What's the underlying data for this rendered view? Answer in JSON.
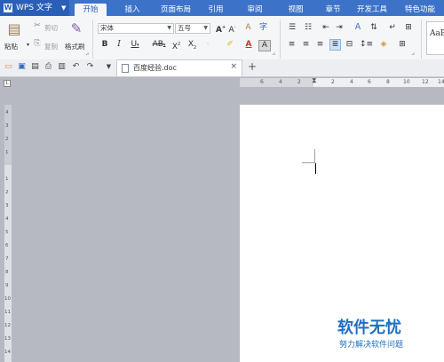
{
  "app": {
    "name": "WPS 文字",
    "logo_letter": "W"
  },
  "tabs": [
    "开始",
    "插入",
    "页面布局",
    "引用",
    "审阅",
    "视图",
    "章节",
    "开发工具",
    "特色功能"
  ],
  "clipboard": {
    "paste": "粘贴",
    "cut": "剪切",
    "copy": "复制",
    "format_painter": "格式刷"
  },
  "font": {
    "name": "宋体",
    "size": "五号"
  },
  "styles_preview": "AaB",
  "document": {
    "tab_title": "百度经验.doc"
  },
  "ruler": {
    "h_numbers": [
      "6",
      "4",
      "2",
      "2",
      "4",
      "6",
      "8",
      "10",
      "12",
      "14",
      "16",
      "18"
    ],
    "v_numbers": [
      "4",
      "3",
      "2",
      "1",
      "1",
      "2",
      "3",
      "4",
      "5",
      "6",
      "7",
      "8",
      "9",
      "10",
      "11",
      "12",
      "13",
      "14"
    ]
  },
  "watermark": {
    "title": "软件无忧",
    "subtitle": "努力解决软件问题"
  },
  "icons": [
    "save-icon",
    "open-icon",
    "print-icon",
    "undo-icon",
    "redo-icon",
    "close-icon",
    "new-tab-icon"
  ]
}
